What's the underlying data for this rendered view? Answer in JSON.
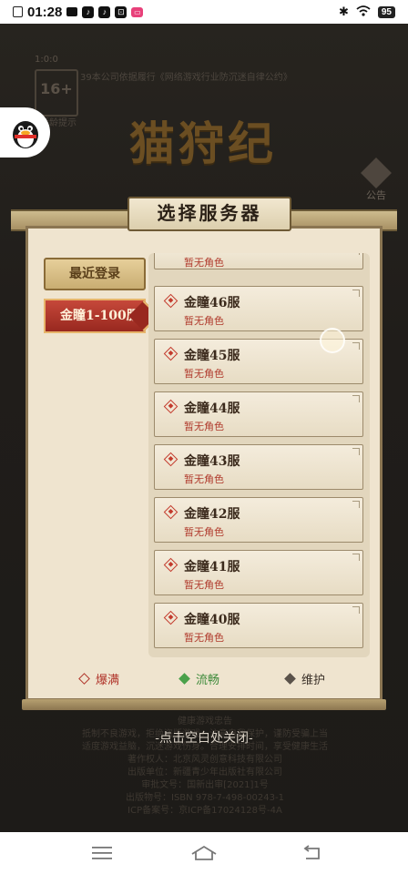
{
  "status_bar": {
    "time": "01:28",
    "battery": "95"
  },
  "game": {
    "age_top": "1:0:0",
    "age_rating": "16+",
    "age_tip": "适龄提示",
    "approval_text": "39本公司依据履行《网络游戏行业防沉迷自律公约》",
    "logo_title": "猫狩纪",
    "notice_label": "公告"
  },
  "dialog": {
    "title": "选择服务器",
    "recent_button": "最近登录",
    "zone_button": "金瞳1-100服",
    "servers": [
      {
        "name": "",
        "role": "暂无角色"
      },
      {
        "name": "金瞳46服",
        "role": "暂无角色"
      },
      {
        "name": "金瞳45服",
        "role": "暂无角色"
      },
      {
        "name": "金瞳44服",
        "role": "暂无角色"
      },
      {
        "name": "金瞳43服",
        "role": "暂无角色"
      },
      {
        "name": "金瞳42服",
        "role": "暂无角色"
      },
      {
        "name": "金瞳41服",
        "role": "暂无角色"
      },
      {
        "name": "金瞳40服",
        "role": "暂无角色"
      }
    ],
    "legend": {
      "full": "爆满",
      "smooth": "流畅",
      "maintenance": "维护"
    },
    "close_hint": "-点击空白处关闭-"
  },
  "footer_lines": [
    "健康游戏忠告",
    "抵制不良游戏，拒绝盗版游戏。注意自我保护，谨防受骗上当",
    "适度游戏益脑，沉迷游戏伤身。合理安排时间，享受健康生活",
    "著作权人：北京风灵创意科技有限公司",
    "出版单位：新疆青少年出版社有限公司",
    "审批文号：国新出审[2021]1号",
    "出版物号：ISBN 978-7-498-00243-1",
    "ICP备案号：京ICP备17024128号-4A"
  ],
  "colors": {
    "accent_red": "#b0342a",
    "smooth_green": "#4aa14a",
    "maintenance_gray": "#5a524a",
    "panel_bg": "#efe4cf"
  }
}
